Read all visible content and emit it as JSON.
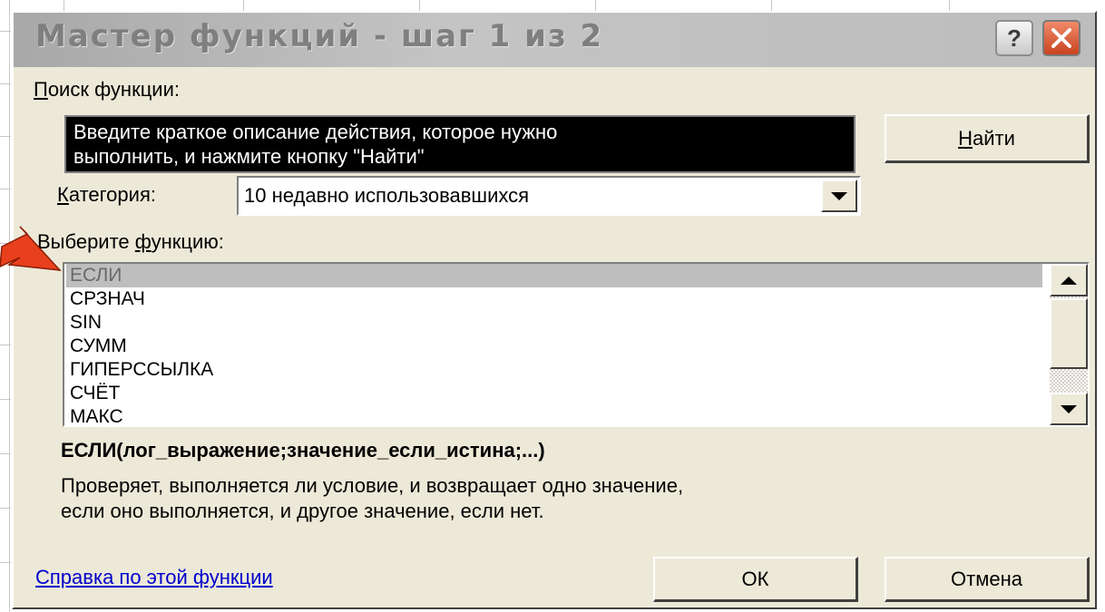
{
  "dialog": {
    "title": "Мастер функций - шаг 1 из 2",
    "help_button_label": "?",
    "search": {
      "label_underlined": "П",
      "label_rest": "оиск функции:",
      "value_line1": "Введите краткое описание действия, которое нужно",
      "value_line2": "выполнить, и нажмите кнопку \"Найти\"",
      "find_button_underlined": "Н",
      "find_button_rest": "айти"
    },
    "category": {
      "label_underlined": "К",
      "label_rest": "атегория:",
      "value": "10 недавно использовавшихся"
    },
    "function_list": {
      "label_before": "Выберите ",
      "label_underlined": "ф",
      "label_after": "ункцию:",
      "items": [
        "ЕСЛИ",
        "СРЗНАЧ",
        "SIN",
        "СУММ",
        "ГИПЕРССЫЛКА",
        "СЧЁТ",
        "МАКС"
      ],
      "selected_index": 0
    },
    "signature": "ЕСЛИ(лог_выражение;значение_если_истина;...)",
    "description_line1": "Проверяет, выполняется ли условие, и возвращает одно значение,",
    "description_line2": "если оно выполняется, и другое значение, если нет.",
    "help_link": "Справка по этой функции",
    "ok_button": "ОК",
    "cancel_button": "Отмена"
  },
  "colors": {
    "dialog_bg": "#ece9d8",
    "title_text": "#7f7f7f",
    "search_bg": "#000000",
    "selected_item_bg": "#bebebe",
    "link": "#0000cc",
    "arrow": "#e8401c"
  },
  "icons": [
    "help-icon",
    "close-icon",
    "dropdown-arrow-icon",
    "scroll-up-icon",
    "scroll-down-icon",
    "pointer-arrow-icon"
  ]
}
